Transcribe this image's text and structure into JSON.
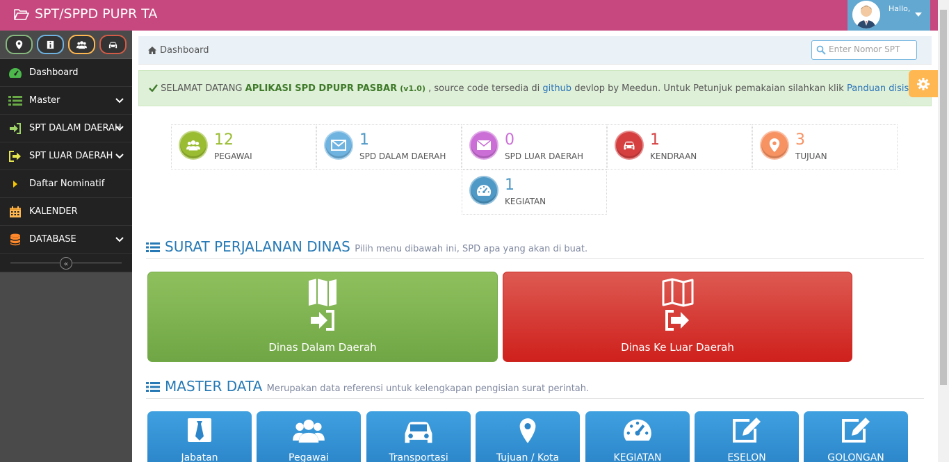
{
  "app": {
    "title": "SPT/SPPD PUPR TA"
  },
  "user": {
    "greeting": "Hallo,"
  },
  "shortcuts": [
    {
      "icon": "map-marker-icon",
      "color": "#87b87f"
    },
    {
      "icon": "info-icon",
      "color": "#6fb3e0"
    },
    {
      "icon": "users-icon",
      "color": "#ffb752"
    },
    {
      "icon": "car-icon",
      "color": "#d15b47"
    }
  ],
  "sidebar": {
    "items": [
      {
        "label": "Dashboard",
        "icon": "tachometer-icon"
      },
      {
        "label": "Master",
        "icon": "list-icon"
      },
      {
        "label": "SPT DALAM DAERAH",
        "icon": "sign-in-icon"
      },
      {
        "label": "SPT LUAR DAERAH",
        "icon": "sign-out-icon"
      },
      {
        "label": "Daftar Nominatif",
        "icon": "caret-right-icon"
      },
      {
        "label": "KALENDER",
        "icon": "calendar-icon"
      },
      {
        "label": "DATABASE",
        "icon": "database-icon"
      }
    ]
  },
  "breadcrumb": {
    "label": "Dashboard"
  },
  "search": {
    "placeholder": "Enter Nomor SPT"
  },
  "alert": {
    "prefix": "SELAMAT DATANG",
    "app_name": "APLIKASI SPD DPUPR PASBAR",
    "version": "(v1.0)",
    "middle": ", source code tersedia di",
    "github": "github",
    "after_github": "devlop by Meedun. Untuk Petunjuk pemakaian silahkan klik",
    "guide": "Panduan disisni",
    "suffix": "."
  },
  "stats": [
    {
      "value": "12",
      "label": "PEGAWAI",
      "color": "#9abc32"
    },
    {
      "value": "1",
      "label": "SPD DALAM DAERAH",
      "color": "#6fb3e0"
    },
    {
      "value": "0",
      "label": "SPD LUAR DAERAH",
      "color": "#cb6fd7"
    },
    {
      "value": "1",
      "label": "KENDRAAN",
      "color": "#d53f40"
    },
    {
      "value": "3",
      "label": "TUJUAN",
      "color": "#f79263"
    },
    {
      "value": "1",
      "label": "KEGIATAN",
      "color": "#4f99c6"
    }
  ],
  "spd_section": {
    "title": "SURAT PERJALANAN DINAS",
    "subtitle": "Pilih menu dibawah ini, SPD apa yang akan di buat."
  },
  "spd_buttons": {
    "dalam": "Dinas Dalam Daerah",
    "luar": "Dinas Ke Luar Daerah"
  },
  "master_section": {
    "title": "MASTER DATA",
    "subtitle": "Merupakan data referensi untuk kelengkapan pengisian surat perintah."
  },
  "master_tiles": [
    {
      "label": "Jabatan",
      "icon": "tie-icon"
    },
    {
      "label": "Pegawai",
      "icon": "users-icon"
    },
    {
      "label": "Transportasi",
      "icon": "car-icon"
    },
    {
      "label": "Tujuan / Kota",
      "icon": "map-marker-icon"
    },
    {
      "label": "KEGIATAN",
      "icon": "tachometer-icon"
    },
    {
      "label": "ESELON",
      "icon": "edit-icon"
    },
    {
      "label": "GOLONGAN",
      "icon": "edit-icon"
    }
  ]
}
